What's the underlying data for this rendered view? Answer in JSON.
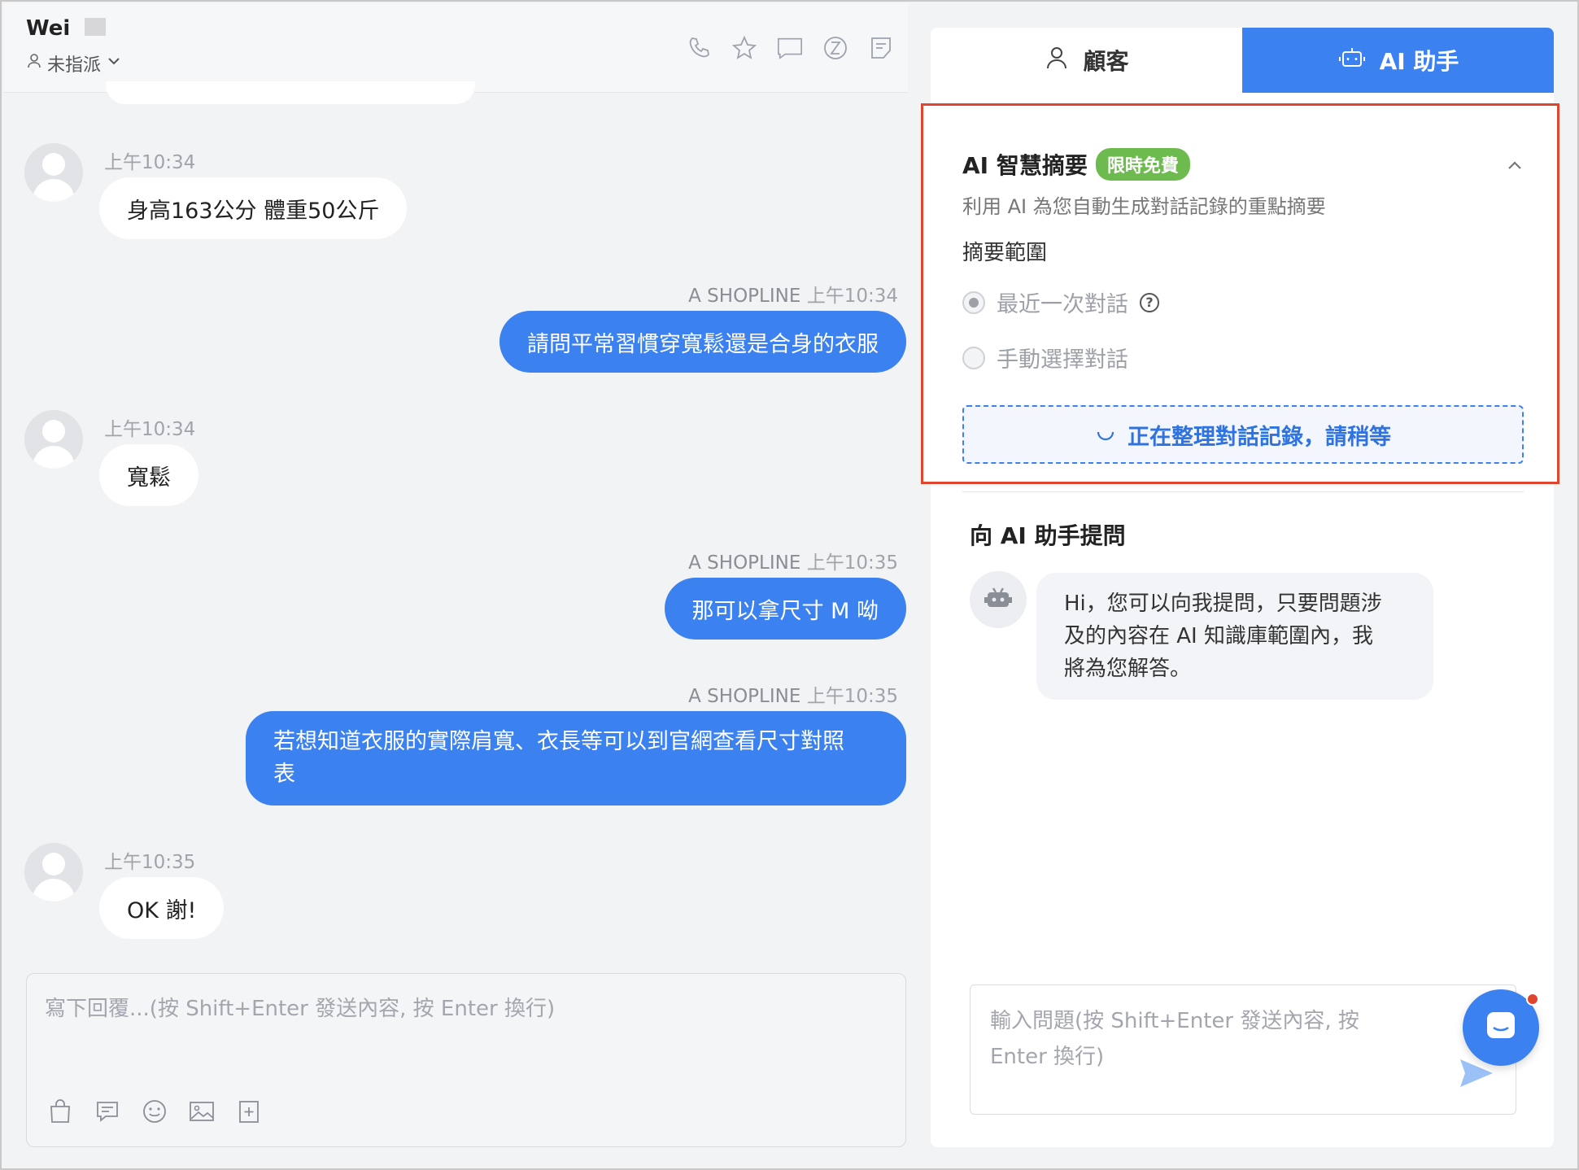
{
  "header": {
    "customer_name": "Wei",
    "assign_status": "未指派"
  },
  "messages": [
    {
      "side": "in",
      "time": "上午10:34",
      "text": "身高163公分 體重50公斤"
    },
    {
      "side": "out",
      "sender": "A SHOPLINE",
      "time": "上午10:34",
      "text": "請問平常習慣穿寬鬆還是合身的衣服"
    },
    {
      "side": "in",
      "time": "上午10:34",
      "text": "寬鬆"
    },
    {
      "side": "out",
      "sender": "A SHOPLINE",
      "time": "上午10:35",
      "text": "那可以拿尺寸 M 呦"
    },
    {
      "side": "out",
      "sender": "A SHOPLINE",
      "time": "上午10:35",
      "text_line1": "若想知道衣服的實際肩寬、衣長等可以到官網查看尺寸對照",
      "text_line2": "表"
    },
    {
      "side": "in",
      "time": "上午10:35",
      "text": "OK 謝!"
    }
  ],
  "composer": {
    "placeholder": "寫下回覆...(按 Shift+Enter 發送內容, 按 Enter 換行)"
  },
  "tabs": {
    "customer": "顧客",
    "ai": "AI 助手"
  },
  "summary": {
    "title": "AI 智慧摘要",
    "badge": "限時免費",
    "description": "利用 AI 為您自動生成對話記錄的重點摘要",
    "scope_label": "摘要範圍",
    "option_recent": "最近一次對話",
    "option_manual": "手動選擇對話",
    "loading_text": "正在整理對話記錄，請稍等"
  },
  "assistant": {
    "title": "向 AI 助手提問",
    "greeting_line1": "Hi，您可以向我提問，只要問題涉",
    "greeting_line2": "及的內容在 AI 知識庫範圍內，我",
    "greeting_line3": "將為您解答。",
    "input_placeholder_line1": "輸入問題(按 Shift+Enter 發送內容, 按",
    "input_placeholder_line2": "Enter 換行)"
  },
  "colors": {
    "accent": "#3b82f0",
    "badge": "#6dbb4f",
    "highlight_border": "#e0452e"
  }
}
